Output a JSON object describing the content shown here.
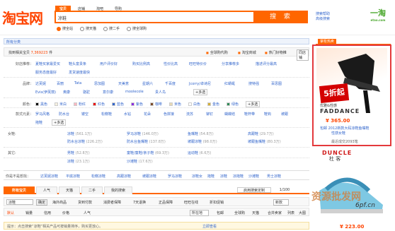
{
  "logo": "淘宝网",
  "search": {
    "tabs": [
      "宝贝",
      "店铺",
      "淘吧",
      "导购"
    ],
    "query": "凉鞋",
    "button": "搜 索",
    "scope": [
      "搜全站",
      "搜天猫",
      "搜二手",
      "搜全球购"
    ],
    "links": [
      "搜索帮助",
      "高级搜索"
    ]
  },
  "brand_ad": {
    "name": "一淘",
    "sub": "etao.com"
  },
  "category_bar": "所有分类",
  "results": {
    "found_prefix": "找到相关宝贝",
    "count": "7,369223",
    "found_suffix": "件",
    "links": [
      "全球购代购",
      "淘宝商城",
      "热门好物推"
    ],
    "select": "同店铺"
  },
  "attributes": [
    {
      "key": "好店推荐：",
      "values": [
        "夏鞋买家最爱买",
        "鞋头富贵条",
        "用户评价好",
        "购买比例高",
        "性价比高",
        "旺旺特价价",
        "分享推荐多",
        "描述评分最高",
        "服务态度最好",
        "发货速度最快"
      ]
    },
    {
      "key": "品牌：",
      "values": [
        "达芙妮",
        "百丽",
        "Tata",
        "思加图",
        "天美意",
        "星期六",
        "千百度",
        "Jcorry/卓诗尼",
        "红蜻蜓",
        "搜特强",
        "百思图",
        "Evis(伊芙丽)",
        "奥康",
        "骆驼",
        "意尔康",
        "moolecole",
        "贵人鸟"
      ],
      "more": "+多选"
    },
    {
      "key": "颜色：",
      "values": [
        "黑色",
        "米白",
        "粉红",
        "红色",
        "蓝色",
        "紫色",
        "咖啡",
        "米色",
        "白色",
        "金色",
        "绿色"
      ],
      "more": "+多选"
    },
    {
      "key": "款式元素：",
      "values": [
        "罗马风格",
        "防水台",
        "镂空",
        "松糕鞋",
        "水钻",
        "花朵",
        "色拼接",
        "流苏",
        "铆钉",
        "蝴蝶结",
        "鞋杯带",
        "鞋钩",
        "坡跟",
        "拖鞋"
      ],
      "more": "+多选"
    }
  ],
  "sections": [
    {
      "key": "女鞋:",
      "items": [
        [
          "凉鞋",
          "(561.1万)"
        ],
        [
          "罗马凉鞋",
          "(146.0万)"
        ],
        [
          "鱼嘴鞋",
          "(54.8万)"
        ],
        [
          "高跟鞋",
          "(29.7万)"
        ],
        [
          "防水台凉鞋",
          "(226.2万)"
        ],
        [
          "防水台鱼嘴鞋",
          "(137.8万)"
        ],
        [
          "坡跟凉鞋",
          "(98.0万)"
        ],
        [
          "坡跟鱼嘴鞋",
          "(80.3万)"
        ]
      ]
    },
    {
      "key": "男鞋:",
      "items": [
        [
          "凉鞋",
          "(23.1万)"
        ],
        [
          "沙滩鞋",
          "(17.6万)"
        ]
      ]
    },
    {
      "key": "其它:",
      "items": [
        [
          "男鞋",
          "(52.8万)"
        ],
        [
          "童鞋/童鞋/亲子鞋",
          "(69.3万)"
        ],
        [
          "运动鞋",
          "(6.6万)"
        ]
      ]
    }
  ],
  "you_want": {
    "label": "你是不是想找：",
    "items": [
      "达芙妮凉鞋",
      "平底凉鞋",
      "松糕凉鞋",
      "高跟凉鞋",
      "坡跟凉鞋",
      "罗马凉鞋",
      "凉鞋女",
      "拖鞋",
      "凉鞋",
      "凉拖鞋",
      "沙滩鞋",
      "男士凉鞋"
    ]
  },
  "bottom_tabs": [
    "所有宝贝",
    "人气",
    "天猫",
    "二手",
    "我的搜索"
  ],
  "list_hint": "启用搜索定制",
  "page_info": "1/100",
  "filter": {
    "input": "凉鞋",
    "btn": "确定",
    "checks": [
      "海外商品",
      "货到付款",
      "消费者保障",
      "7天退换",
      "正品保障",
      "旺旺在线",
      "折扣促销"
    ],
    "region": "新款"
  },
  "sort": {
    "items": [
      "默认",
      "销量",
      "信用",
      "价格",
      "人气"
    ],
    "region": "所在地",
    "checks": [
      "包邮",
      "全球购",
      "天猫",
      "合并卖家"
    ],
    "views": [
      "列表",
      "大图"
    ]
  },
  "tip": "提示：点击搜索“凉鞋”相关产品可按销量排序，购买更放心。",
  "tip_link": "立即查看",
  "promo": {
    "title": "掌柜热卖",
    "sale": "5折起",
    "slogan": "优雅&性感",
    "brand": "FADDANCE",
    "price": "¥ 365.00",
    "desc": "包邮 2012新款大码凉鞋鱼嘴鞋",
    "desc2": "性感女鞋",
    "sold": "最近成交2093笔"
  },
  "ad2": {
    "brand": "DUNCLE",
    "sub": "杜 客",
    "price": "¥ 223.00"
  },
  "watermark": {
    "cn": "资源批发网",
    "url": "6pf.cn"
  }
}
